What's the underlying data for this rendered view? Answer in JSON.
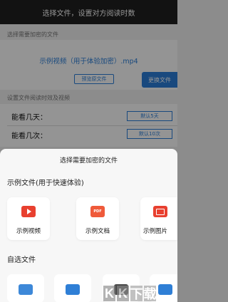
{
  "app": {
    "title": "选择文件，设置对方阅读时数",
    "select_label": "选择需要加密的文件",
    "file_name": "示例视频（用于体验加密）.mp4",
    "preview_label": "预览原文件",
    "change_label": "更换文件",
    "settings_label": "设置文件阅读时效及视频",
    "days_label": "能看几天：",
    "days_value": "默认5天",
    "times_label": "能看几次：",
    "times_value": "默认10次"
  },
  "sheet": {
    "title": "选择需要加密的文件",
    "sample_group_title": "示例文件(用于快速体验)",
    "samples": [
      {
        "label": "示例视频",
        "icon": "video-icon"
      },
      {
        "label": "示例文档",
        "icon": "pdf-icon",
        "icon_text": "PDF"
      },
      {
        "label": "示例图片",
        "icon": "image-icon"
      }
    ],
    "custom_group_title": "自选文件",
    "custom_items": [
      {
        "icon": "camera-icon"
      },
      {
        "icon": "gallery-icon"
      },
      {
        "icon": "video-icon"
      },
      {
        "icon": "folder-icon"
      }
    ]
  },
  "colors": {
    "accent": "#2b7fd9",
    "title_bar": "#1f1f1f",
    "icon_red": "#e8402f"
  }
}
